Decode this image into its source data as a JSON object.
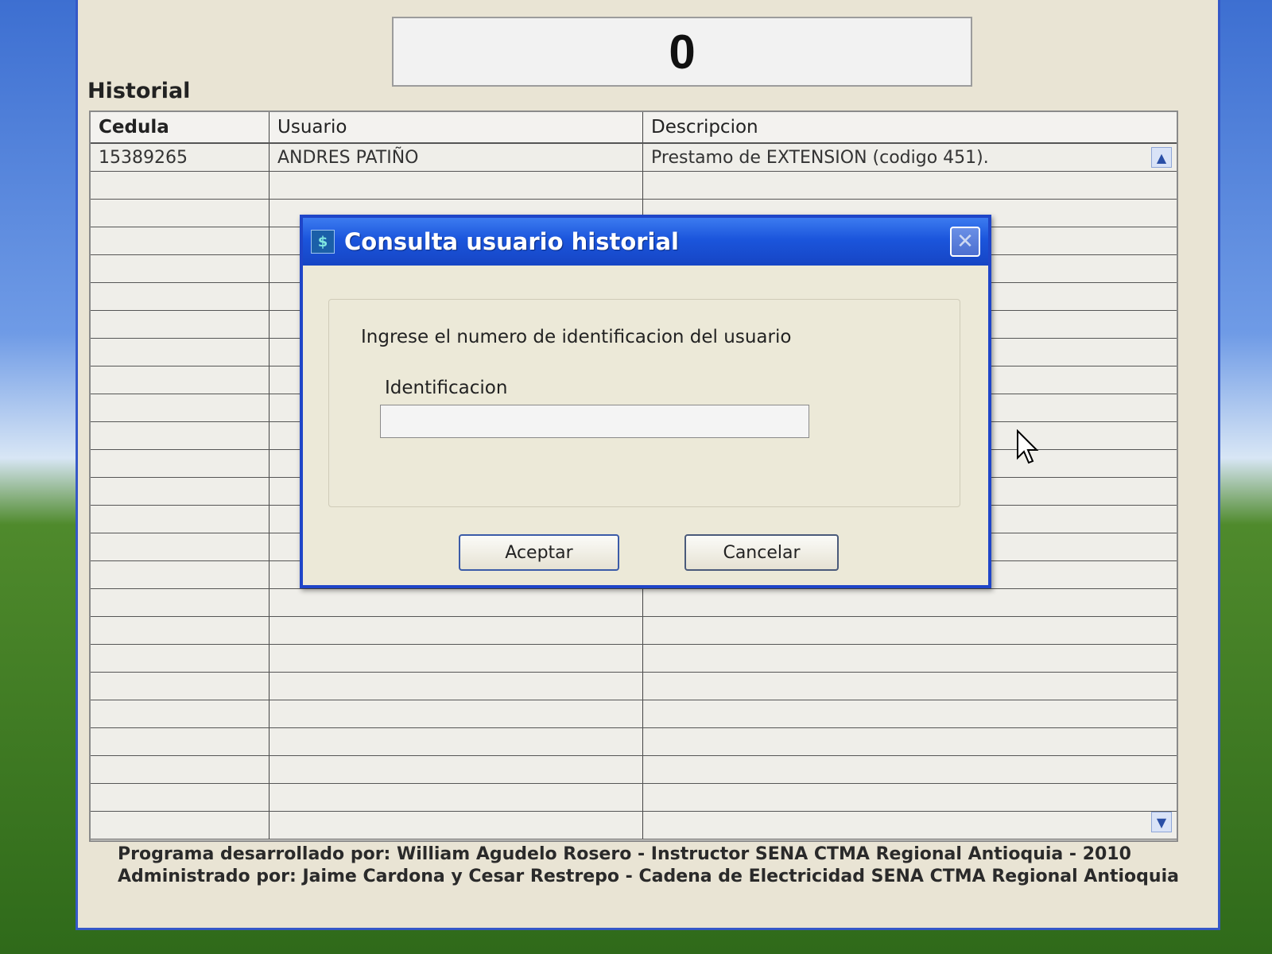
{
  "counter": {
    "value": "0"
  },
  "history": {
    "title": "Historial",
    "columns": [
      "Cedula",
      "Usuario",
      "Descripcion"
    ],
    "rows": [
      {
        "cedula": "15389265",
        "usuario": "ANDRES PATIÑO",
        "descripcion": "Prestamo de EXTENSION (codigo 451)."
      }
    ]
  },
  "footer": {
    "line1": "Programa desarrollado por: William Agudelo Rosero - Instructor SENA CTMA Regional Antioquia - 2010",
    "line2": "Administrado por: Jaime Cardona y Cesar Restrepo - Cadena de Electricidad SENA CTMA Regional Antioquia"
  },
  "dialog": {
    "title": "Consulta usuario historial",
    "prompt": "Ingrese el numero de identificacion del usuario",
    "field_label": "Identificacion",
    "field_value": "",
    "ok_label": "Aceptar",
    "cancel_label": "Cancelar"
  },
  "colors": {
    "titlebar": "#1b55dc",
    "dialog_bg": "#ece9d8",
    "window_border": "#3558c8"
  }
}
